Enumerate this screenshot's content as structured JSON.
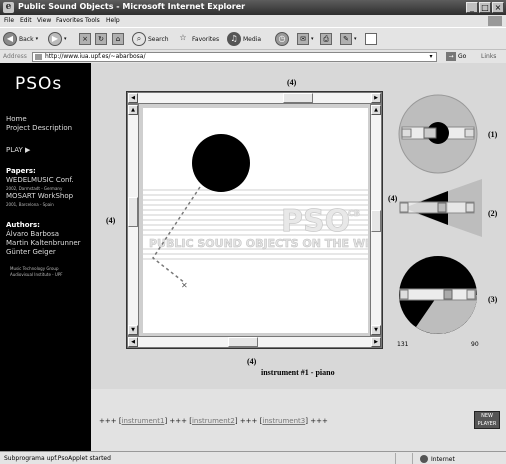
{
  "window": {
    "title": "Public Sound Objects - Microsoft Internet Explorer",
    "icon": "ie-icon",
    "controls": [
      "_",
      "□",
      "×"
    ]
  },
  "menu": {
    "items": [
      "File",
      "Edit",
      "View",
      "Favorites",
      "Tools",
      "Help"
    ]
  },
  "toolbar": {
    "back": "Back",
    "search": "Search",
    "favorites": "Favorites",
    "media": "Media"
  },
  "address": {
    "label": "Address",
    "url": "http://www.iua.upf.es/~abarbosa/",
    "go": "Go",
    "links": "Links"
  },
  "sidebar": {
    "logo": "PSOs",
    "home": "Home",
    "project": "Project Description",
    "play": "PLAY ▶",
    "papers_heading": "Papers:",
    "paper1": "WEDELMUSIC Conf.",
    "paper1_info": "2002, Darmstadt - Germany",
    "paper2": "MOSART WorkShop",
    "paper2_info": "2001, Barcelona - Spain",
    "authors_heading": "Authors:",
    "authors": [
      "Álvaro Barbosa",
      "Martin Kaltenbrunner",
      "Günter Geiger"
    ],
    "group_line1": "Music Technology Group",
    "group_line2": "Audiovisual Institute - UPF"
  },
  "applet": {
    "dim_top": "(4)",
    "dim_left": "(4)",
    "dim_right": "(4)",
    "dim_bottom": "(4)",
    "watermark_big": "PSO",
    "watermark_sub": "CB",
    "watermark_text": "PUBLIC SOUND OBJECTS ON THE WE",
    "control_labels": [
      "(1)",
      "(2)",
      "(3)"
    ],
    "value_left": "131",
    "value_right": "90",
    "instrument": "instrument #1 - piano"
  },
  "bottom_links": {
    "sep": "+++",
    "items": [
      "instrument1",
      "instrument2",
      "instrument3"
    ],
    "corner": "NEW PLAYER"
  },
  "status": {
    "text": "Subprograma upf.PsoApplet started",
    "zone": "Internet"
  }
}
